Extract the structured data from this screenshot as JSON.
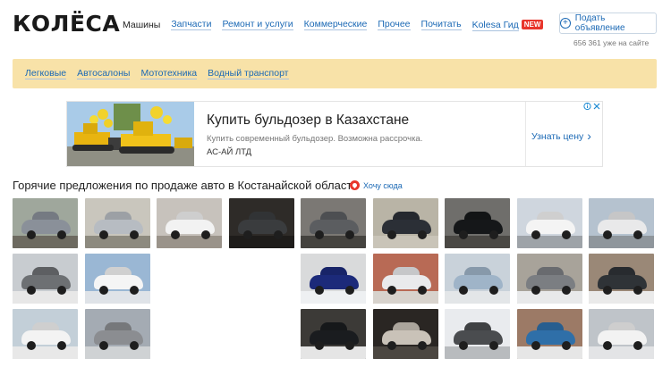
{
  "header": {
    "logo": "КОЛЁСА",
    "nav": [
      {
        "label": "Машины",
        "active": true
      },
      {
        "label": "Запчасти",
        "active": false
      },
      {
        "label": "Ремонт и услуги",
        "active": false
      },
      {
        "label": "Коммерческие",
        "active": false
      },
      {
        "label": "Прочее",
        "active": false
      },
      {
        "label": "Почитать",
        "active": false
      },
      {
        "label": "Kolesa Гид",
        "active": false,
        "badge": "NEW"
      }
    ],
    "post_button": "Подать объявление",
    "online_count": "656 361 уже на сайте"
  },
  "categories": [
    "Легковые",
    "Автосалоны",
    "Мототехника",
    "Водный транспорт"
  ],
  "ad": {
    "title": "Купить бульдозер в Казахстане",
    "description": "Купить современный бульдозер. Возможна рассрочка.",
    "company": "АС-АЙ ЛТД",
    "cta": "Узнать цену",
    "badge_icons": [
      "info-icon",
      "close-icon"
    ]
  },
  "hot": {
    "title": "Горячие предложения по продаже авто в Костанайской области",
    "want_link": "Хочу сюда",
    "thumbnails": [
      {
        "row": 0,
        "col": 0,
        "car": "#8a9099",
        "bg": "#9fa79c",
        "ground": "#6d6a60"
      },
      {
        "row": 0,
        "col": 1,
        "car": "#b7bcc2",
        "bg": "#c9c6bd",
        "ground": "#8d8a7f"
      },
      {
        "row": 0,
        "col": 2,
        "car": "#f2f2f2",
        "bg": "#c7c2bc",
        "ground": "#9a938a"
      },
      {
        "row": 0,
        "col": 3,
        "car": "#3a3c3e",
        "bg": "#2e2b28",
        "ground": "#1e1c1a"
      },
      {
        "row": 0,
        "col": 4,
        "car": "#5b5d60",
        "bg": "#7b7874",
        "ground": "#45433f"
      },
      {
        "row": 0,
        "col": 5,
        "car": "#2b2f36",
        "bg": "#b9b4a6",
        "ground": "#c9c4b8"
      },
      {
        "row": 0,
        "col": 6,
        "car": "#151719",
        "bg": "#6f6e6b",
        "ground": "#4a4844"
      },
      {
        "row": 0,
        "col": 7,
        "car": "#f4f4f4",
        "bg": "#cfd6de",
        "ground": "#9ea3a8"
      },
      {
        "row": 0,
        "col": 8,
        "car": "#e9e9ea",
        "bg": "#b5c2cf",
        "ground": "#8f969c"
      },
      {
        "row": 1,
        "col": 0,
        "car": "#6d7073",
        "bg": "#c8ccd0",
        "ground": "#e7e7e7"
      },
      {
        "row": 1,
        "col": 1,
        "car": "#f5f5f5",
        "bg": "#9ab7d4",
        "ground": "#dfe3e8"
      },
      {
        "row": 1,
        "col": 4,
        "car": "#1c2a7a",
        "bg": "#d9dadb",
        "ground": "#eef0f2"
      },
      {
        "row": 1,
        "col": 5,
        "car": "#e9eaec",
        "bg": "#b86a55",
        "ground": "#d7d2cc"
      },
      {
        "row": 1,
        "col": 6,
        "car": "#9fb4c8",
        "bg": "#c9d2da",
        "ground": "#e3e6e8"
      },
      {
        "row": 1,
        "col": 7,
        "car": "#7b7e82",
        "bg": "#a8a39a",
        "ground": "#e8e9ea"
      },
      {
        "row": 1,
        "col": 8,
        "car": "#2f3337",
        "bg": "#9a8877",
        "ground": "#eaeaea"
      },
      {
        "row": 2,
        "col": 0,
        "car": "#f3f3f3",
        "bg": "#c3cfd8",
        "ground": "#e8e8e8"
      },
      {
        "row": 2,
        "col": 1,
        "car": "#8b8d91",
        "bg": "#a4abb3",
        "ground": "#cfd2d4"
      },
      {
        "row": 2,
        "col": 4,
        "car": "#1a1c1f",
        "bg": "#3c3a37",
        "ground": "#e5e5e5"
      },
      {
        "row": 2,
        "col": 5,
        "car": "#c9c2b8",
        "bg": "#2a2623",
        "ground": "#4b4640"
      },
      {
        "row": 2,
        "col": 6,
        "car": "#4a4c4f",
        "bg": "#e9ebee",
        "ground": "#b8bbbe"
      },
      {
        "row": 2,
        "col": 7,
        "car": "#2f6fa8",
        "bg": "#9c7a66",
        "ground": "#e6e6e6"
      },
      {
        "row": 2,
        "col": 8,
        "car": "#f2f2f2",
        "bg": "#bfc4c9",
        "ground": "#e3e4e6"
      }
    ]
  }
}
